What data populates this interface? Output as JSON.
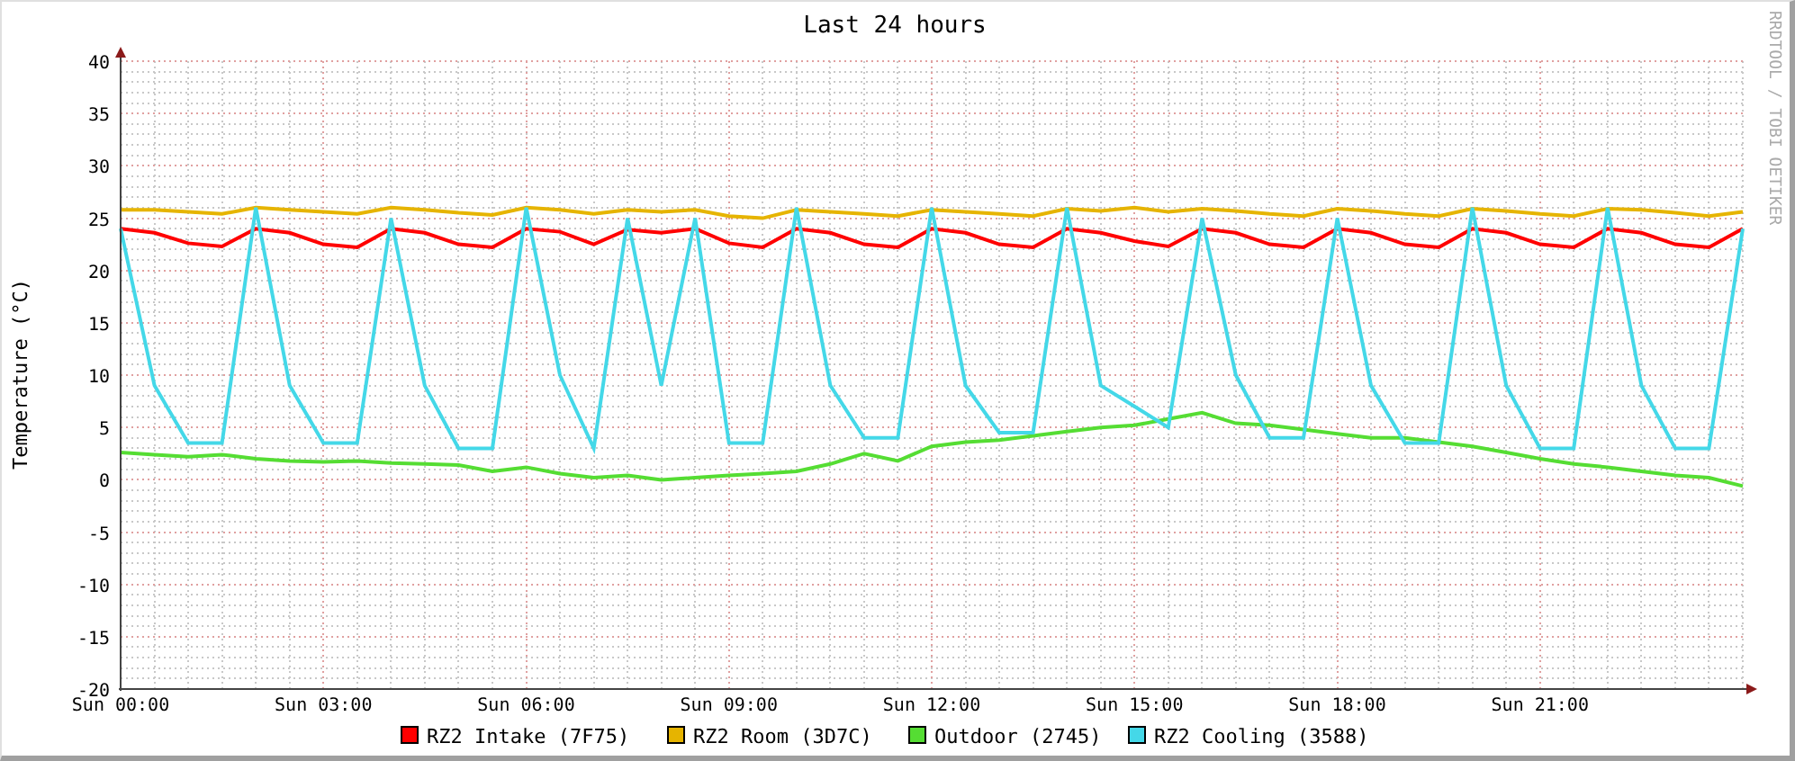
{
  "graph": {
    "credit": "RRDTOOL / TOBI OETIKER",
    "chart_data": {
      "type": "line",
      "grid": true,
      "legend": "bottom",
      "title": "Last 24 hours",
      "ylabel": "Temperature (°C)",
      "ylim": [
        -20,
        40
      ],
      "categories": [
        "Sun 00:00",
        null,
        null,
        null,
        null,
        null,
        "Sun 03:00",
        null,
        null,
        null,
        null,
        null,
        "Sun 06:00",
        null,
        null,
        null,
        null,
        null,
        "Sun 09:00",
        null,
        null,
        null,
        null,
        null,
        "Sun 12:00",
        null,
        null,
        null,
        null,
        null,
        "Sun 15:00",
        null,
        null,
        null,
        null,
        null,
        "Sun 18:00",
        null,
        null,
        null,
        null,
        null,
        "Sun 21:00",
        null,
        null,
        null,
        null,
        null,
        null
      ],
      "yticks": [
        -20,
        -15,
        -10,
        -5,
        0,
        5,
        10,
        15,
        20,
        25,
        30,
        35,
        40
      ],
      "series": [
        {
          "name": "RZ2 Intake (7F75)",
          "color": "#ff0000",
          "values": [
            24,
            23.6,
            22.6,
            22.3,
            24,
            23.6,
            22.5,
            22.2,
            24,
            23.6,
            22.5,
            22.2,
            24,
            23.7,
            22.5,
            23.9,
            23.6,
            24,
            22.6,
            22.2,
            24,
            23.6,
            22.5,
            22.2,
            24,
            23.6,
            22.5,
            22.2,
            24,
            23.6,
            22.8,
            22.3,
            24,
            23.6,
            22.5,
            22.2,
            24,
            23.6,
            22.5,
            22.2,
            24,
            23.6,
            22.5,
            22.2,
            24,
            23.6,
            22.5,
            22.2,
            24
          ]
        },
        {
          "name": "RZ2 Room (3D7C)",
          "color": "#e6b400",
          "values": [
            25.8,
            25.8,
            25.6,
            25.4,
            26,
            25.8,
            25.6,
            25.4,
            26,
            25.8,
            25.5,
            25.3,
            26,
            25.8,
            25.4,
            25.8,
            25.6,
            25.8,
            25.2,
            25,
            25.8,
            25.6,
            25.4,
            25.2,
            25.8,
            25.6,
            25.4,
            25.2,
            25.9,
            25.7,
            26,
            25.6,
            25.9,
            25.7,
            25.4,
            25.2,
            25.9,
            25.7,
            25.4,
            25.2,
            25.9,
            25.7,
            25.4,
            25.2,
            25.9,
            25.8,
            25.5,
            25.2,
            25.6
          ]
        },
        {
          "name": "Outdoor (2745)",
          "color": "#55dd33",
          "values": [
            2.6,
            2.4,
            2.2,
            2.4,
            2,
            1.8,
            1.7,
            1.8,
            1.6,
            1.5,
            1.4,
            0.8,
            1.2,
            0.6,
            0.2,
            0.4,
            0,
            0.2,
            0.4,
            0.6,
            0.8,
            1.5,
            2.5,
            1.8,
            3.2,
            3.6,
            3.8,
            4.2,
            4.6,
            5,
            5.2,
            5.8,
            6.4,
            5.4,
            5.2,
            4.8,
            4.4,
            4,
            4,
            3.6,
            3.2,
            2.6,
            2,
            1.5,
            1.2,
            0.8,
            0.4,
            0.2,
            -0.6
          ]
        },
        {
          "name": "RZ2 Cooling (3588)",
          "color": "#44d8e8",
          "values": [
            24,
            9,
            3.5,
            3.5,
            26,
            9,
            3.5,
            3.5,
            25,
            9,
            3,
            3,
            26,
            10,
            3,
            25,
            9,
            25,
            3.5,
            3.5,
            26,
            9,
            4,
            4,
            26,
            9,
            4.5,
            4.5,
            26,
            9,
            7,
            5,
            25,
            10,
            4,
            4,
            25,
            9,
            3.5,
            3.5,
            26,
            9,
            3,
            3,
            26,
            9,
            3,
            3,
            24
          ]
        }
      ]
    }
  }
}
